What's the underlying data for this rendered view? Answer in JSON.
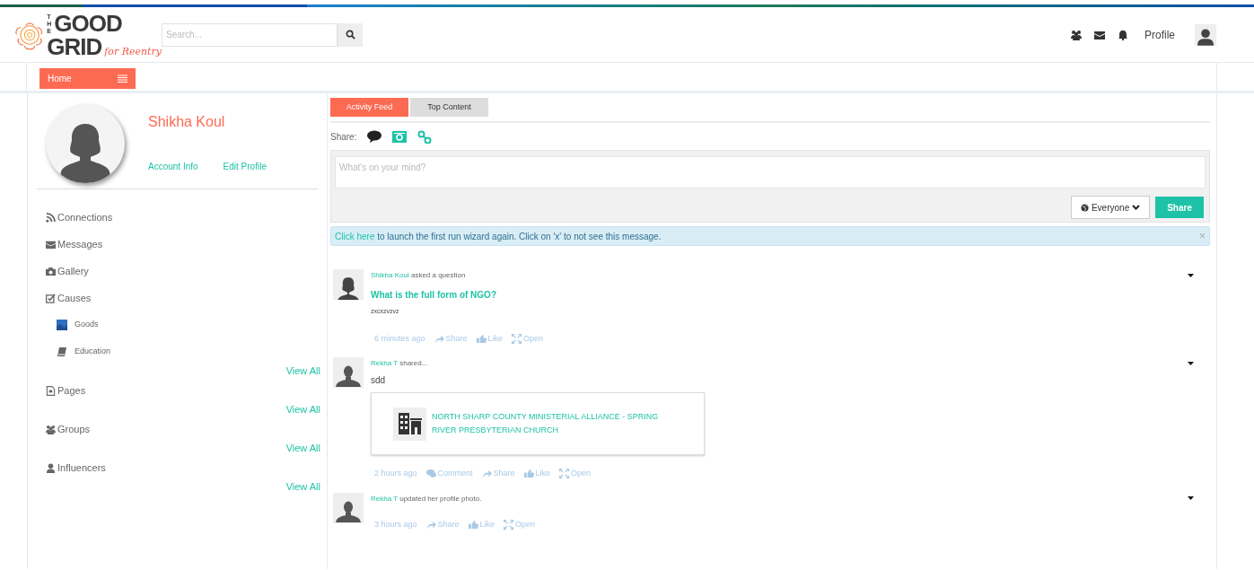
{
  "logo": {
    "the": "THE",
    "good": "GOOD",
    "grid": "GRID",
    "tagline": "for Reentry"
  },
  "search": {
    "placeholder": "Search..."
  },
  "header_nav": [
    {
      "kind": "people"
    },
    {
      "kind": "mail"
    },
    {
      "kind": "bell"
    },
    {
      "kind": "text",
      "label": "Profile"
    },
    {
      "kind": "avatar"
    }
  ],
  "home_button": {
    "label": "Home"
  },
  "profile": {
    "name": "Shikha Koul",
    "links": [
      "Account Info",
      "Edit Profile"
    ]
  },
  "sidebar": [
    {
      "kind": "rss",
      "label": "Connections"
    },
    {
      "kind": "mail",
      "label": "Messages"
    },
    {
      "kind": "camera",
      "label": "Gallery"
    },
    {
      "kind": "check",
      "label": "Causes",
      "children": [
        {
          "kind": "tile",
          "label": "Goods"
        },
        {
          "kind": "book",
          "label": "Education"
        }
      ],
      "view_all": "View All"
    },
    {
      "kind": "page",
      "label": "Pages",
      "view_all": "View All"
    },
    {
      "kind": "people",
      "label": "Groups",
      "view_all": "View All"
    },
    {
      "kind": "user",
      "label": "Influencers",
      "view_all": "View All"
    }
  ],
  "tabs": [
    {
      "label": "Activity Feed",
      "selected": true
    },
    {
      "label": "Top Content",
      "selected": false
    }
  ],
  "share_bar": {
    "label": "Share:",
    "options": [
      {
        "kind": "status",
        "selected": true
      },
      {
        "kind": "photo",
        "selected": false
      },
      {
        "kind": "link",
        "selected": false
      }
    ]
  },
  "composer": {
    "placeholder": "What's on your mind?",
    "audience": "Everyone",
    "submit": "Share"
  },
  "notice": {
    "link": "Click here",
    "text": " to launch the first run wizard again. Click on 'x' to not see this message.",
    "close": "×"
  },
  "feed": [
    {
      "actor": "Shikha Koul",
      "action": " asked a question",
      "title": "What is the full form of NGO?",
      "body": "zxcxzvzvz",
      "actions": [
        {
          "kind": "time",
          "label": "6 minutes ago"
        },
        {
          "kind": "share",
          "label": "Share"
        },
        {
          "kind": "like",
          "label": "Like"
        },
        {
          "kind": "open",
          "label": "Open"
        }
      ]
    },
    {
      "actor": "Rekha T",
      "action": " shared...",
      "text": "sdd",
      "link_card": {
        "title": "NORTH SHARP COUNTY MINISTERIAL ALLIANCE - SPRING RIVER PRESBYTERIAN CHURCH"
      },
      "actions": [
        {
          "kind": "time",
          "label": "2 hours ago"
        },
        {
          "kind": "comment",
          "label": "Comment"
        },
        {
          "kind": "share",
          "label": "Share"
        },
        {
          "kind": "like",
          "label": "Like"
        },
        {
          "kind": "open",
          "label": "Open"
        }
      ]
    },
    {
      "actor": "Rekha T",
      "action": " updated her profile photo.",
      "actions": [
        {
          "kind": "time",
          "label": "3 hours ago"
        },
        {
          "kind": "share",
          "label": "Share"
        },
        {
          "kind": "like",
          "label": "Like"
        },
        {
          "kind": "open",
          "label": "Open"
        }
      ]
    }
  ]
}
